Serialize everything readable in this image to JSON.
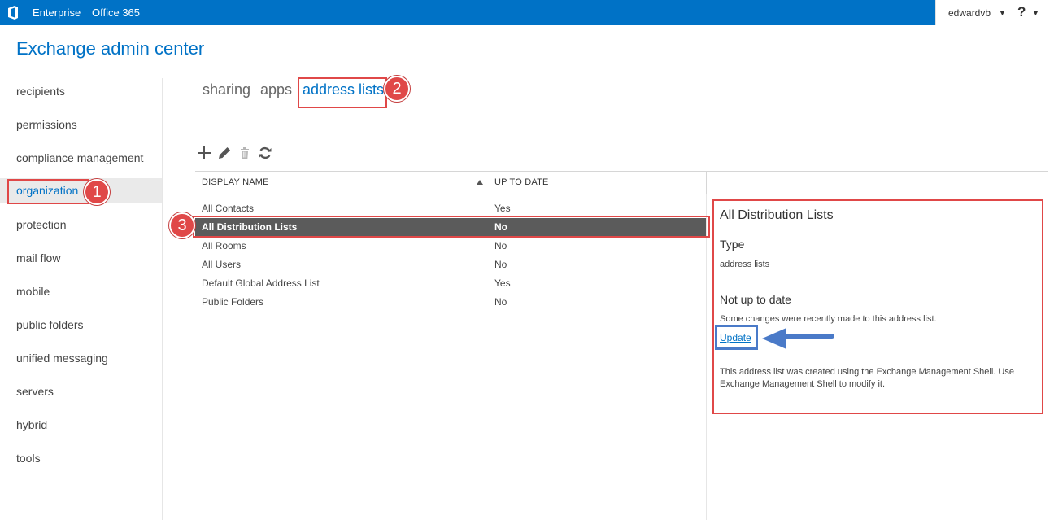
{
  "topbar": {
    "links": [
      "Enterprise",
      "Office 365"
    ],
    "user": "edwardvb",
    "help": "?"
  },
  "app_title": "Exchange admin center",
  "nav": {
    "items": [
      "recipients",
      "permissions",
      "compliance management",
      "organization",
      "protection",
      "mail flow",
      "mobile",
      "public folders",
      "unified messaging",
      "servers",
      "hybrid",
      "tools"
    ],
    "active": "organization"
  },
  "tabs": {
    "items": [
      "sharing",
      "apps",
      "address lists"
    ],
    "active": "address lists"
  },
  "toolbar": {
    "icons": [
      "add-icon",
      "edit-icon",
      "delete-icon",
      "refresh-icon"
    ]
  },
  "table": {
    "columns": [
      "DISPLAY NAME",
      "UP TO DATE"
    ],
    "rows": [
      [
        "All Contacts",
        "Yes"
      ],
      [
        "All Distribution Lists",
        "No"
      ],
      [
        "All Rooms",
        "No"
      ],
      [
        "All Users",
        "No"
      ],
      [
        "Default Global Address List",
        "Yes"
      ],
      [
        "Public Folders",
        "No"
      ]
    ],
    "selected": "All Distribution Lists"
  },
  "details": {
    "title": "All Distribution Lists",
    "type_heading": "Type",
    "type_value": "address lists",
    "status_heading": "Not up to date",
    "status_text": "Some changes were recently made to this address list.",
    "update_link": "Update",
    "note": "This address list was created using the Exchange Management Shell. Use Exchange Management Shell to modify it."
  },
  "annotations": {
    "badges": [
      "1",
      "2",
      "3"
    ],
    "box_color": "#e04848",
    "arrow_color": "#4a7ac8"
  },
  "colors": {
    "brand": "#0072c6",
    "selected_row": "#5b5b5b"
  }
}
